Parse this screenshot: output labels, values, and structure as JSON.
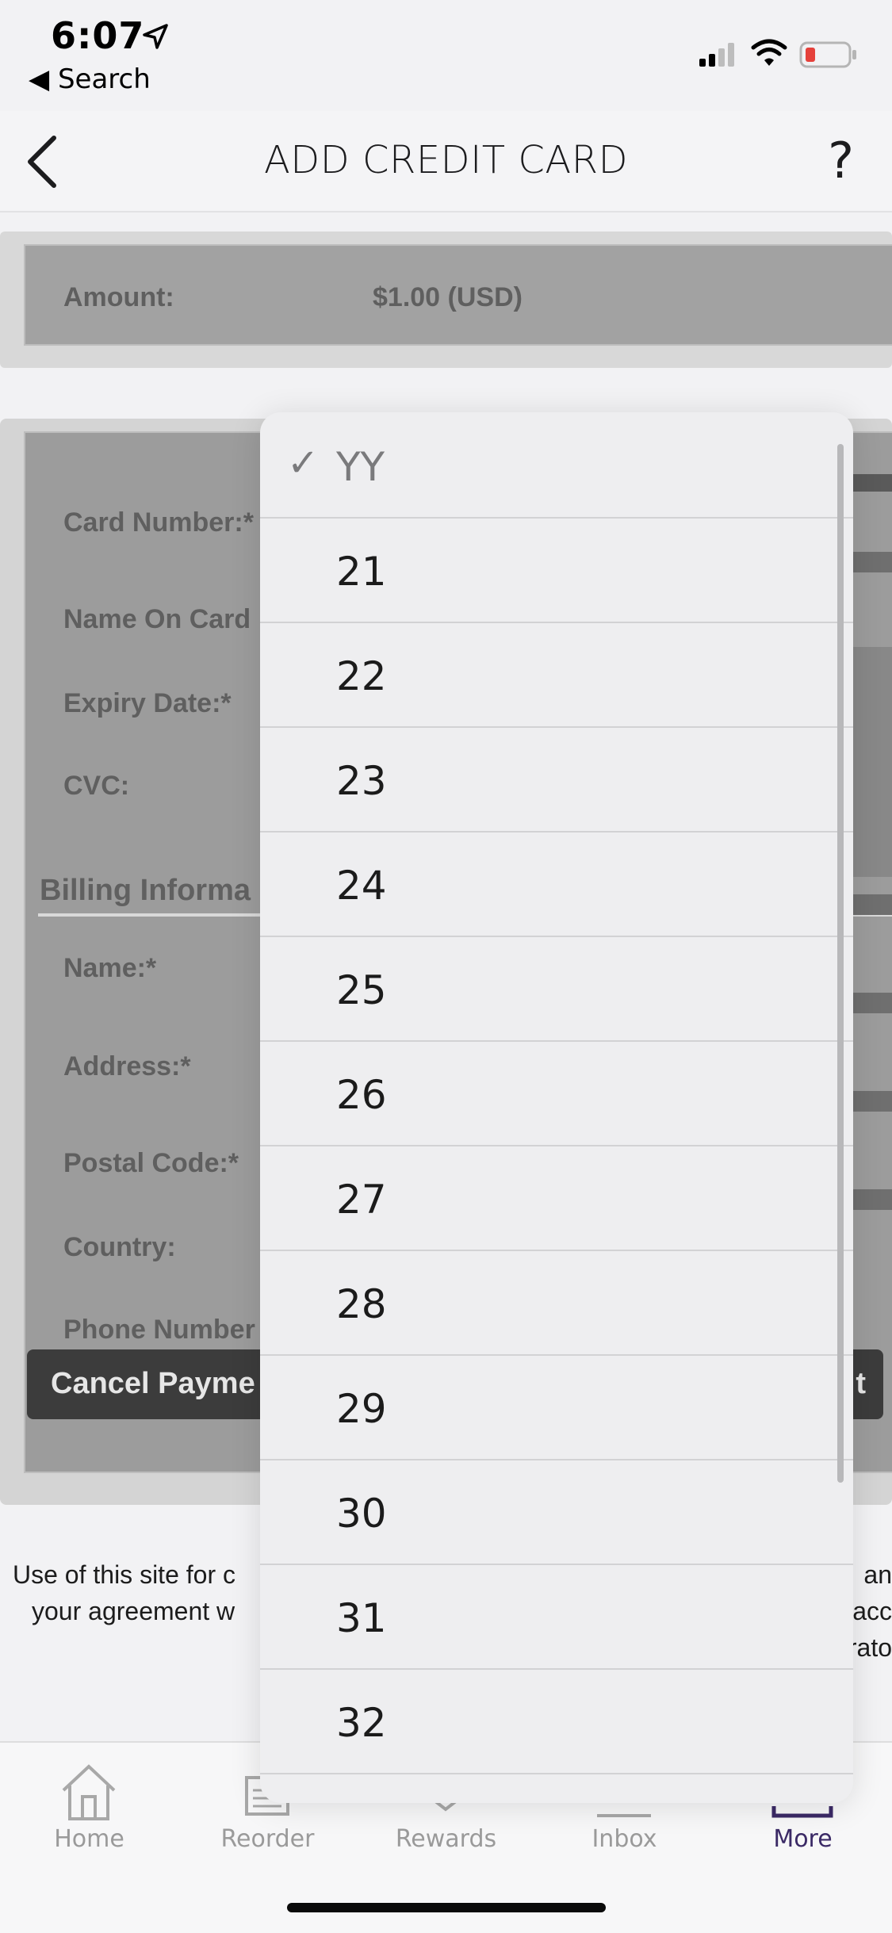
{
  "status_bar": {
    "time": "6:07",
    "back_app": "◀ Search"
  },
  "nav": {
    "title": "ADD CREDIT CARD",
    "help": "?"
  },
  "amount": {
    "label": "Amount:",
    "value": "$1.00 (USD)"
  },
  "form": {
    "card_number": "Card Number:*",
    "name_on_card": "Name On Card",
    "expiry": "Expiry Date:*",
    "cvc": "CVC:",
    "billing_heading": "Billing Informa",
    "name": "Name:*",
    "address": "Address:*",
    "postal": "Postal Code:*",
    "country": "Country:",
    "phone": "Phone Number",
    "cancel_button": "Cancel Payme",
    "submit_fragment": "t"
  },
  "footer": {
    "line1_left": "Use of this site for c",
    "line2_left": "your agreement w",
    "line1_right": "an",
    "line2_right": "acc",
    "line3_right": "rato"
  },
  "picker": {
    "options": [
      {
        "label": "YY",
        "selected": true
      },
      {
        "label": "21",
        "selected": false
      },
      {
        "label": "22",
        "selected": false
      },
      {
        "label": "23",
        "selected": false
      },
      {
        "label": "24",
        "selected": false
      },
      {
        "label": "25",
        "selected": false
      },
      {
        "label": "26",
        "selected": false
      },
      {
        "label": "27",
        "selected": false
      },
      {
        "label": "28",
        "selected": false
      },
      {
        "label": "29",
        "selected": false
      },
      {
        "label": "30",
        "selected": false
      },
      {
        "label": "31",
        "selected": false
      },
      {
        "label": "32",
        "selected": false
      }
    ],
    "check_mark": "✓"
  },
  "tabs": [
    {
      "label": "Home",
      "icon": "home-icon",
      "active": false
    },
    {
      "label": "Reorder",
      "icon": "receipt-icon",
      "active": false
    },
    {
      "label": "Rewards",
      "icon": "bookmark-icon",
      "active": false
    },
    {
      "label": "Inbox",
      "icon": "inbox-icon",
      "active": false
    },
    {
      "label": "More",
      "icon": "more-icon",
      "active": true
    }
  ],
  "colors": {
    "active_tab": "#3b2a66",
    "inactive_tab": "#9a9a9a",
    "battery_low": "#e5413b"
  }
}
